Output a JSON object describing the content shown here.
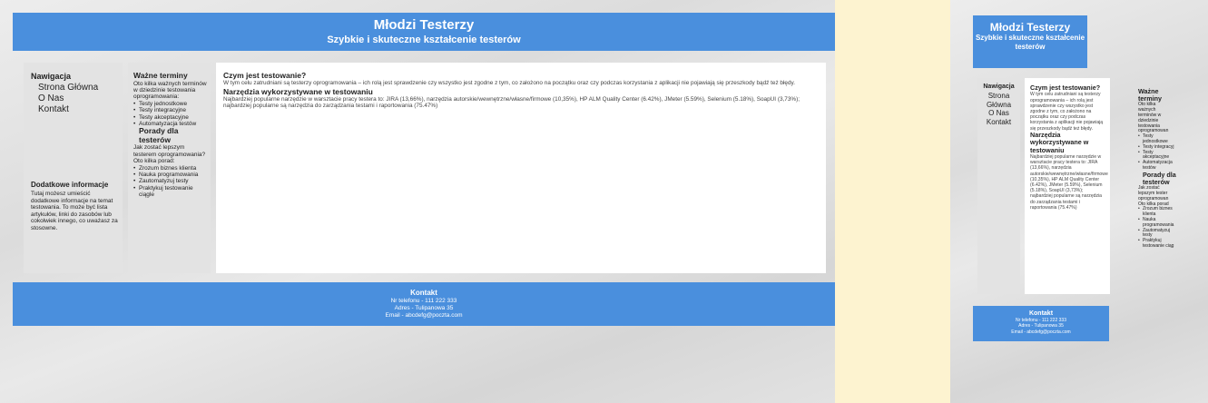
{
  "site": {
    "title": "Młodzi Testerzy",
    "subtitle": "Szybkie i skuteczne kształcenie testerów",
    "mobile_subtitle_line1": "Szybkie i skuteczne kształcenie",
    "mobile_subtitle_line2": "testerów"
  },
  "nav": {
    "title": "Nawigacja",
    "items": [
      {
        "label": "Strona Główna"
      },
      {
        "label": "O Nas"
      },
      {
        "label": "Kontakt"
      }
    ],
    "mobile_items": [
      "Strona",
      "Główna",
      "O Nas",
      "Kontakt"
    ]
  },
  "info": {
    "title": "Dodatkowe informacje",
    "text": "Tutaj możesz umieścić dodatkowe informacje na temat testowania. To może być lista artykułów, linki do zasobów lub cokolwiek innego, co uważasz za stosowne."
  },
  "terms": {
    "title": "Ważne terminy",
    "intro": "Oto kilka ważnych terminów w dziedzinie testowania oprogramowania:",
    "items": [
      "Testy jednostkowe",
      "Testy integracyjne",
      "Testy akceptacyjne",
      "Automatyzacja testów"
    ],
    "advice_title": "Porady dla testerów",
    "advice_intro": "Jak zostać lepszym testerem oprogramowania? Oto kilka porad:",
    "advice_items": [
      "Zrozum biznes klienta",
      "Nauka programowania",
      "Zautomatyzuj testy",
      "Praktykuj testowanie ciągle"
    ],
    "mobile_title_line1": "Ważne",
    "mobile_title_line2": "terminy",
    "mobile_intro_lines": [
      "Oto kilka",
      "ważnych",
      "terminów w",
      "dziedzinie",
      "testowania",
      "oprogramowan"
    ],
    "mobile_items": [
      "Testy",
      "jednostkowe",
      "Testy integracyj",
      "Testy",
      "akceptacyjne",
      "Automatyzacja",
      "testów"
    ],
    "mobile_advice_title": "Porady dla",
    "mobile_advice_title2": "testerów",
    "mobile_advice_intro_lines": [
      "Jak zostać",
      "lepszym tester",
      "oprogramowan",
      "Oto kilka porad"
    ],
    "mobile_advice_items": [
      "Zrozum biznes",
      "klienta",
      "Nauka",
      "programowania",
      "Zautomatyzuj",
      "testy",
      "Praktykuj",
      "testowanie ciąg"
    ]
  },
  "main": {
    "heading1": "Czym jest testowanie?",
    "text1": "W tym celu zatrudniani są testerzy oprogramowania – ich rolą jest sprawdzenie czy wszystko jest zgodne z tym, co założono na początku oraz czy podczas korzystania z aplikacji nie pojawiają się przeszkody bądź też błędy.",
    "heading2": "Narzędzia wykorzystywane w testowaniu",
    "text2": "Najbardziej popularne narzędzie w warsztacie pracy testera to: JIRA (13,66%), narzędzia autorskie/wewnętrzne/własne/firmowe (10,35%), HP ALM Quality Center (6.42%), JMeter (5.59%), Selenium (5.18%), SoapUI (3,73%); najbardziej popularne są narzędzia do zarządzania testami i raportowania (75.47%)",
    "mobile_heading2": "Narzędzia wykorzystywane w testowaniu",
    "mobile_text2": "Najbardziej popularne narzędzie w warsztacie pracy testera to: JIRA (13,66%), narzędzia autorskie/wewnętrzne/własne/firmowe (10,35%), HP ALM Quality Center (6.42%), JMeter (5.59%), Selenium (5.18%), SoapUI (3,73%); najbardziej popularne są narzędzia do zarządzania testami i raportowania (75.47%)"
  },
  "footer": {
    "title": "Kontakt",
    "phone": "Nr telefonu - 111 222 333",
    "address": "Adres - Tulipanowa 35",
    "email": "Email - abcdefg@poczta.com"
  },
  "colors": {
    "page_background": "#fdf3d0",
    "header_blue": "#4a8fdd",
    "sidebar_gray": "#e3e3e3",
    "content_white": "#ffffff"
  }
}
